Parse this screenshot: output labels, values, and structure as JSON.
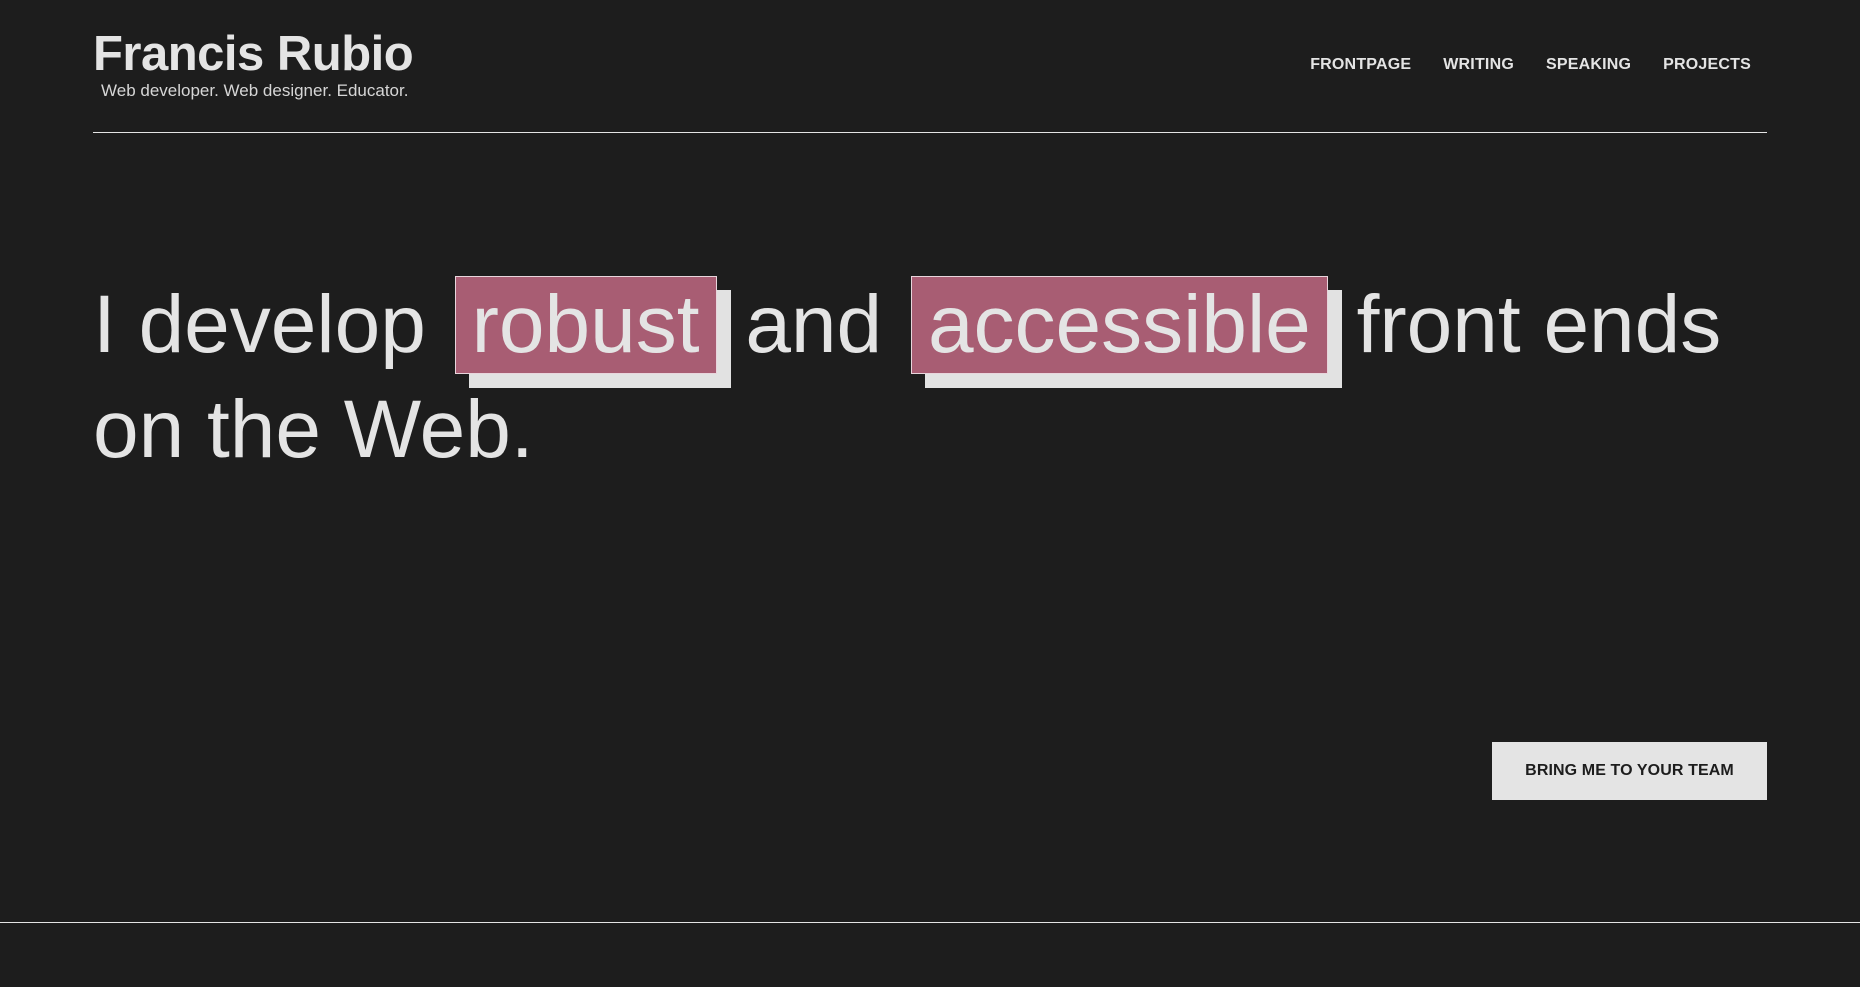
{
  "header": {
    "name": "Francis Rubio",
    "tagline": "Web developer. Web designer. Educator.",
    "nav": [
      "FRONTPAGE",
      "WRITING",
      "SPEAKING",
      "PROJECTS"
    ]
  },
  "hero": {
    "part1": "I develop",
    "highlight1": "robust",
    "part2": "and",
    "highlight2": "accessible",
    "part3": "front ends on the Web."
  },
  "cta": {
    "label": "BRING ME TO YOUR TEAM"
  },
  "colors": {
    "background": "#1d1d1d",
    "text": "#e4e4e4",
    "highlight": "#a85d73",
    "highlight_shadow": "#e2e2e2"
  }
}
